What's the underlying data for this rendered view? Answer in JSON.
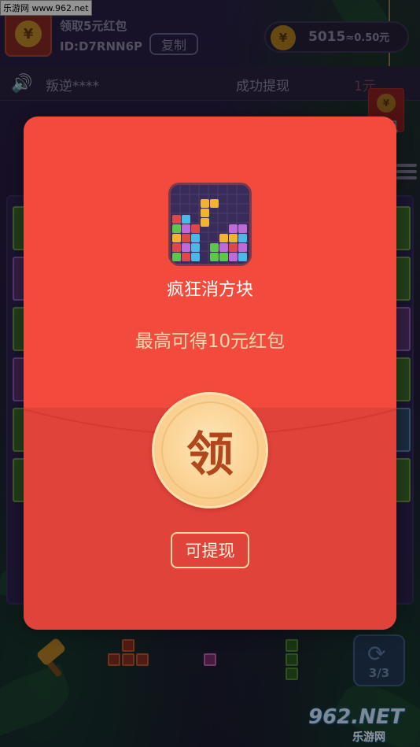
{
  "watermark": {
    "top_text": "乐游网 www.962.net",
    "bottom_main": "962.NET",
    "bottom_sub": "乐游网"
  },
  "header": {
    "yen_symbol": "¥",
    "claim_label": "领取5元红包",
    "user_id": "ID:D7RNN6P",
    "copy_label": "复制",
    "balance_coins": "5015",
    "balance_value": "≈0.50元"
  },
  "ticker": {
    "user": "叛逆****",
    "message": "成功提现",
    "amount": "1元"
  },
  "hanging_envelope": {
    "label": "现"
  },
  "modal": {
    "app_name": "疯狂消方块",
    "reward_text": "最高可得10元红包",
    "claim_label": "领",
    "withdraw_label": "可提现",
    "colors": {
      "upper": "#f24b3d",
      "lower": "#e0433a",
      "coin": "#f9cc8a",
      "claim_text": "#b2461c"
    }
  },
  "tray": {
    "refresh_count": "3/3"
  }
}
